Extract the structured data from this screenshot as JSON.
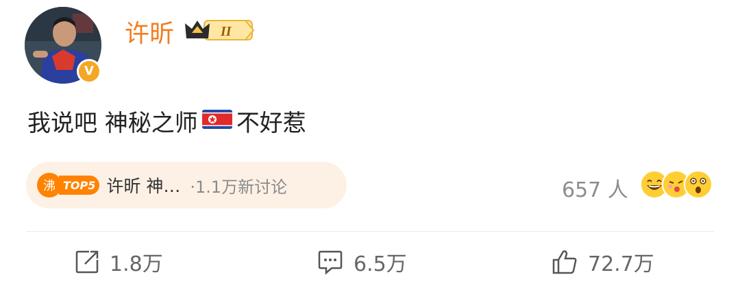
{
  "post": {
    "author": "许昕",
    "vip_level": "II",
    "verified_mark": "V",
    "text_before_flag": "我说吧 神秘之师",
    "text_after_flag": "不好惹"
  },
  "topic": {
    "hot_icon_char": "沸",
    "rank": "TOP5",
    "title": "许昕 神…",
    "discussion": "·1.1万新讨论"
  },
  "reactions": {
    "count": "657 人",
    "emojis": [
      "laughing-emoji-icon",
      "kissing-emoji-icon",
      "shocked-emoji-icon"
    ]
  },
  "actions": {
    "repost_count": "1.8万",
    "comment_count": "6.5万",
    "like_count": "72.7万"
  },
  "colors": {
    "username": "#f47d1f",
    "hot_orange": "#ff8200",
    "pill_bg": "#fdf1e6",
    "muted": "#8c8c8c"
  }
}
